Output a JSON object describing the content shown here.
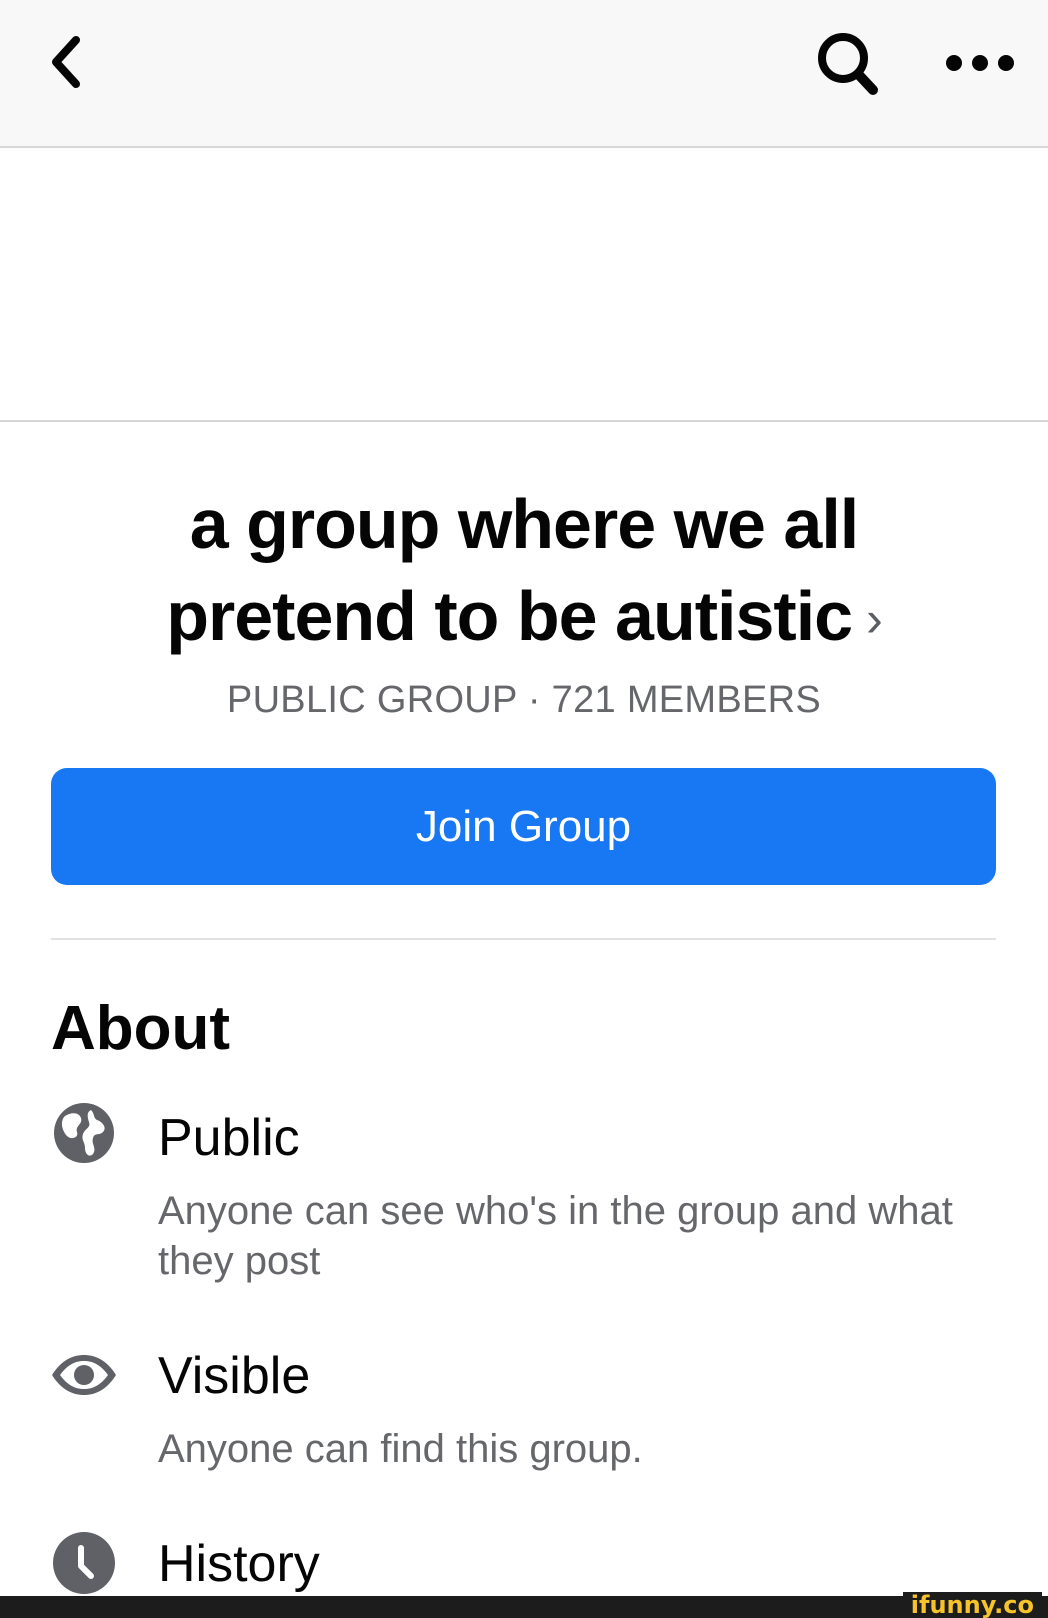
{
  "header": {
    "back_icon": "chevron-left-icon",
    "search_icon": "search-icon",
    "more_icon": "more-horizontal-icon"
  },
  "group": {
    "name_line1": "a group where we all",
    "name_line2": "pretend to be autistic",
    "chevron": "›",
    "meta": "PUBLIC GROUP · 721 MEMBERS"
  },
  "join_button": {
    "label": "Join Group"
  },
  "about": {
    "heading": "About",
    "items": [
      {
        "icon": "globe-icon",
        "title": "Public",
        "description": "Anyone can see who's in the group and what they post"
      },
      {
        "icon": "eye-icon",
        "title": "Visible",
        "description": "Anyone can find this group."
      },
      {
        "icon": "clock-icon",
        "title": "History",
        "description": ""
      }
    ]
  },
  "watermark": {
    "text": "ifunny.co"
  },
  "colors": {
    "accent": "#1877f2",
    "text_primary": "#050505",
    "text_secondary": "#65676b",
    "icon_gray": "#5f6166",
    "watermark": "#f6c32a"
  }
}
